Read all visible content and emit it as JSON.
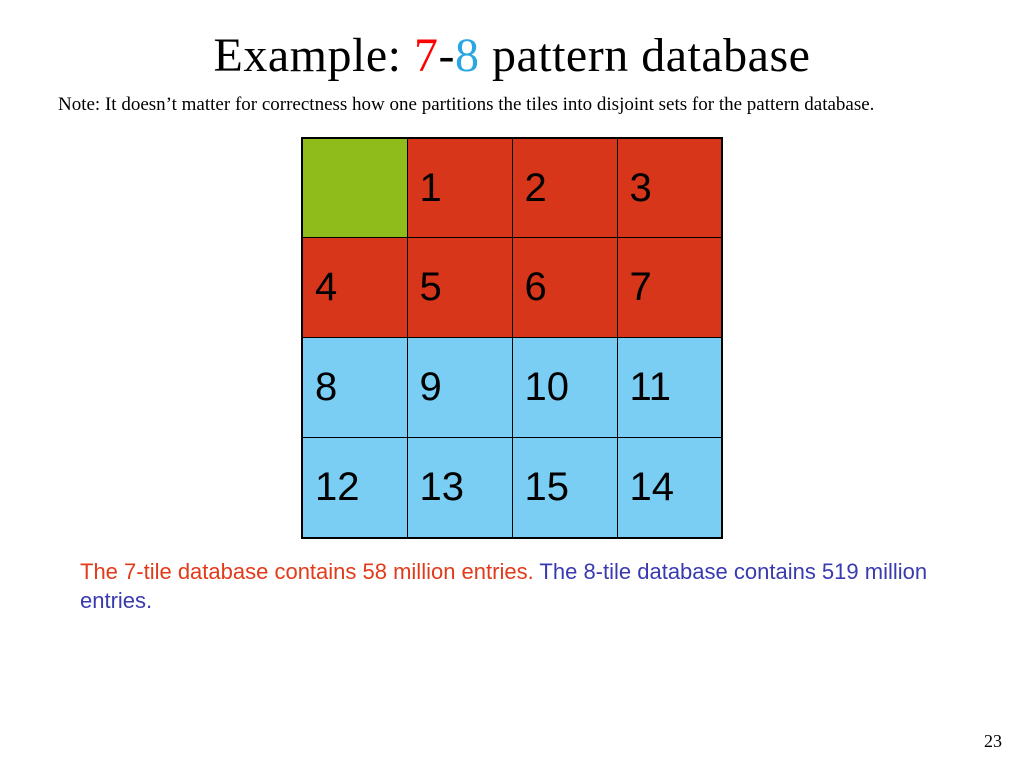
{
  "title": {
    "prefix": "Example: ",
    "seven": "7",
    "dash": "-",
    "eight": "8",
    "suffix": " pattern database"
  },
  "note": "Note: It doesn’t matter for correctness how one partitions the tiles into disjoint sets for the pattern database.",
  "grid": [
    [
      {
        "label": "",
        "color": "green"
      },
      {
        "label": "1",
        "color": "red"
      },
      {
        "label": "2",
        "color": "red"
      },
      {
        "label": "3",
        "color": "red"
      }
    ],
    [
      {
        "label": "4",
        "color": "red"
      },
      {
        "label": "5",
        "color": "red"
      },
      {
        "label": "6",
        "color": "red"
      },
      {
        "label": "7",
        "color": "red"
      }
    ],
    [
      {
        "label": "8",
        "color": "blue"
      },
      {
        "label": "9",
        "color": "blue"
      },
      {
        "label": "10",
        "color": "blue"
      },
      {
        "label": "11",
        "color": "blue"
      }
    ],
    [
      {
        "label": "12",
        "color": "blue"
      },
      {
        "label": "13",
        "color": "blue"
      },
      {
        "label": "15",
        "color": "blue"
      },
      {
        "label": "14",
        "color": "blue"
      }
    ]
  ],
  "caption": {
    "seven_text": "The 7-tile database contains 58 million entries.",
    "eight_text": "The 8-tile database contains 519 million entries."
  },
  "page_number": "23"
}
